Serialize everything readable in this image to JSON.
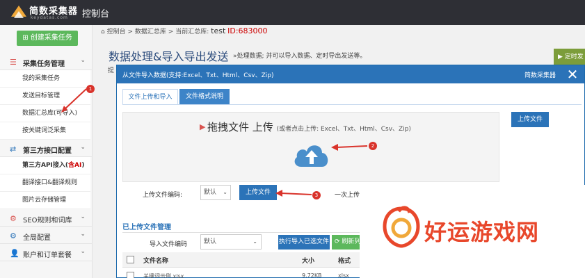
{
  "app": {
    "logo_text": "简数采集器",
    "logo_sub": "keydatas.com",
    "title": "控制台"
  },
  "sidebar": {
    "create_label": "创建采集任务",
    "groups": [
      {
        "label": "采集任务管理",
        "items": [
          "我的采集任务",
          "发送目标管理",
          "数据汇总库(可导入)",
          "按关键词泛采集"
        ]
      },
      {
        "label": "第三方接口配置",
        "items": [
          "第三方API接入(",
          "翻译接口&翻译规则",
          "图片云存储管理"
        ],
        "item0_red": "含AI",
        "item0_tail": ")"
      },
      {
        "label": "SEO规则和词库"
      },
      {
        "label": "全局配置"
      },
      {
        "label": "账户和订单套餐"
      }
    ]
  },
  "breadcrumb": {
    "home": "控制台",
    "sep": ">",
    "level2": "数据汇总库",
    "current_label": "当前汇总库:",
    "current_name": "test",
    "id": "ID:683000"
  },
  "page": {
    "title": "数据处理&导入导出发送",
    "subtitle": "»处理数据; 并可以导入数据、定时导出发送等。",
    "timer_label": "定时发",
    "faded": "提"
  },
  "modal": {
    "title": "从文件导入数据(支持:Excel、Txt、Html、Csv、Zip)",
    "brand": "简数采集器",
    "close": "✕",
    "tabs": [
      "文件上传和导入",
      "文件格式说明"
    ],
    "drop_title": "拖拽文件 上传",
    "drop_hint": "(或者点击上传: Excel、Txt、Html、Csv、Zip)",
    "upload_right": "上传文件",
    "encoding_label": "上传文件编码:",
    "encoding_value": "默认",
    "upload_btn": "上传文件",
    "once_label": "一次上传",
    "uploaded_title": "已上传文件管理",
    "import_encoding_label": "导入文件编码",
    "import_encoding_value": "默认",
    "exec_btn": "执行导入已选文件",
    "refresh_btn": "刷新列",
    "table_headers": [
      "文件名称",
      "大小",
      "格式"
    ],
    "row": [
      "关键词示例.xlsx",
      "9.72KB",
      "xlsx"
    ]
  },
  "annotations": [
    "1",
    "2",
    "3"
  ],
  "watermark": "好运游戏网",
  "colors": {
    "topbar": "#2e2f35",
    "primary": "#2b73b8",
    "green": "#5cb85c",
    "annotation": "#d9332b",
    "watermark": "#e8472b"
  }
}
